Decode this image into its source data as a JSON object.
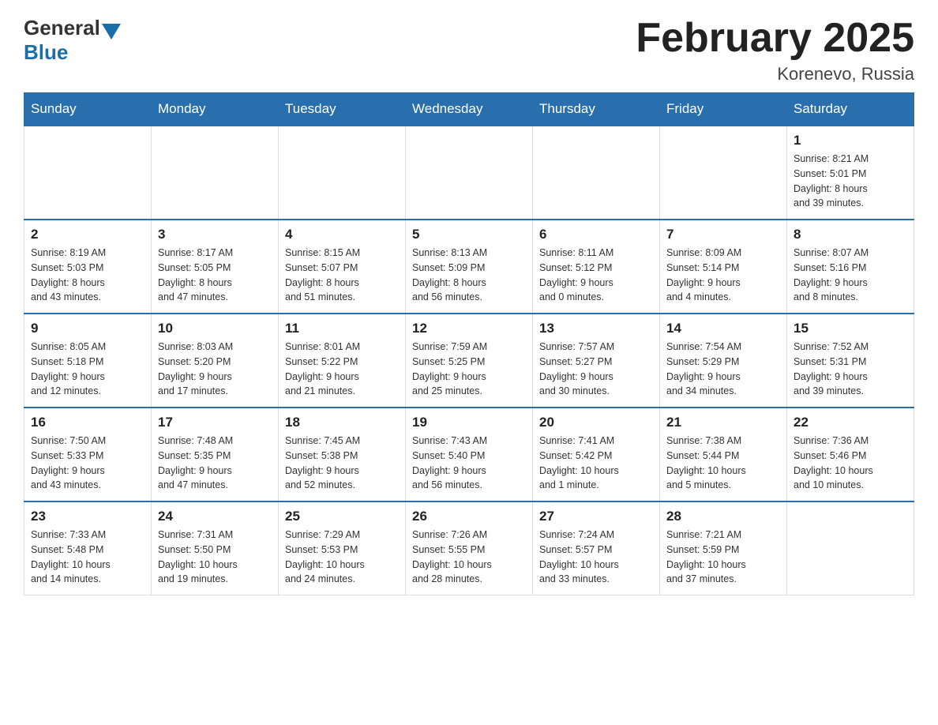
{
  "header": {
    "logo_general": "General",
    "logo_blue": "Blue",
    "month_title": "February 2025",
    "location": "Korenevo, Russia"
  },
  "weekdays": [
    "Sunday",
    "Monday",
    "Tuesday",
    "Wednesday",
    "Thursday",
    "Friday",
    "Saturday"
  ],
  "weeks": [
    [
      {
        "day": "",
        "info": ""
      },
      {
        "day": "",
        "info": ""
      },
      {
        "day": "",
        "info": ""
      },
      {
        "day": "",
        "info": ""
      },
      {
        "day": "",
        "info": ""
      },
      {
        "day": "",
        "info": ""
      },
      {
        "day": "1",
        "info": "Sunrise: 8:21 AM\nSunset: 5:01 PM\nDaylight: 8 hours\nand 39 minutes."
      }
    ],
    [
      {
        "day": "2",
        "info": "Sunrise: 8:19 AM\nSunset: 5:03 PM\nDaylight: 8 hours\nand 43 minutes."
      },
      {
        "day": "3",
        "info": "Sunrise: 8:17 AM\nSunset: 5:05 PM\nDaylight: 8 hours\nand 47 minutes."
      },
      {
        "day": "4",
        "info": "Sunrise: 8:15 AM\nSunset: 5:07 PM\nDaylight: 8 hours\nand 51 minutes."
      },
      {
        "day": "5",
        "info": "Sunrise: 8:13 AM\nSunset: 5:09 PM\nDaylight: 8 hours\nand 56 minutes."
      },
      {
        "day": "6",
        "info": "Sunrise: 8:11 AM\nSunset: 5:12 PM\nDaylight: 9 hours\nand 0 minutes."
      },
      {
        "day": "7",
        "info": "Sunrise: 8:09 AM\nSunset: 5:14 PM\nDaylight: 9 hours\nand 4 minutes."
      },
      {
        "day": "8",
        "info": "Sunrise: 8:07 AM\nSunset: 5:16 PM\nDaylight: 9 hours\nand 8 minutes."
      }
    ],
    [
      {
        "day": "9",
        "info": "Sunrise: 8:05 AM\nSunset: 5:18 PM\nDaylight: 9 hours\nand 12 minutes."
      },
      {
        "day": "10",
        "info": "Sunrise: 8:03 AM\nSunset: 5:20 PM\nDaylight: 9 hours\nand 17 minutes."
      },
      {
        "day": "11",
        "info": "Sunrise: 8:01 AM\nSunset: 5:22 PM\nDaylight: 9 hours\nand 21 minutes."
      },
      {
        "day": "12",
        "info": "Sunrise: 7:59 AM\nSunset: 5:25 PM\nDaylight: 9 hours\nand 25 minutes."
      },
      {
        "day": "13",
        "info": "Sunrise: 7:57 AM\nSunset: 5:27 PM\nDaylight: 9 hours\nand 30 minutes."
      },
      {
        "day": "14",
        "info": "Sunrise: 7:54 AM\nSunset: 5:29 PM\nDaylight: 9 hours\nand 34 minutes."
      },
      {
        "day": "15",
        "info": "Sunrise: 7:52 AM\nSunset: 5:31 PM\nDaylight: 9 hours\nand 39 minutes."
      }
    ],
    [
      {
        "day": "16",
        "info": "Sunrise: 7:50 AM\nSunset: 5:33 PM\nDaylight: 9 hours\nand 43 minutes."
      },
      {
        "day": "17",
        "info": "Sunrise: 7:48 AM\nSunset: 5:35 PM\nDaylight: 9 hours\nand 47 minutes."
      },
      {
        "day": "18",
        "info": "Sunrise: 7:45 AM\nSunset: 5:38 PM\nDaylight: 9 hours\nand 52 minutes."
      },
      {
        "day": "19",
        "info": "Sunrise: 7:43 AM\nSunset: 5:40 PM\nDaylight: 9 hours\nand 56 minutes."
      },
      {
        "day": "20",
        "info": "Sunrise: 7:41 AM\nSunset: 5:42 PM\nDaylight: 10 hours\nand 1 minute."
      },
      {
        "day": "21",
        "info": "Sunrise: 7:38 AM\nSunset: 5:44 PM\nDaylight: 10 hours\nand 5 minutes."
      },
      {
        "day": "22",
        "info": "Sunrise: 7:36 AM\nSunset: 5:46 PM\nDaylight: 10 hours\nand 10 minutes."
      }
    ],
    [
      {
        "day": "23",
        "info": "Sunrise: 7:33 AM\nSunset: 5:48 PM\nDaylight: 10 hours\nand 14 minutes."
      },
      {
        "day": "24",
        "info": "Sunrise: 7:31 AM\nSunset: 5:50 PM\nDaylight: 10 hours\nand 19 minutes."
      },
      {
        "day": "25",
        "info": "Sunrise: 7:29 AM\nSunset: 5:53 PM\nDaylight: 10 hours\nand 24 minutes."
      },
      {
        "day": "26",
        "info": "Sunrise: 7:26 AM\nSunset: 5:55 PM\nDaylight: 10 hours\nand 28 minutes."
      },
      {
        "day": "27",
        "info": "Sunrise: 7:24 AM\nSunset: 5:57 PM\nDaylight: 10 hours\nand 33 minutes."
      },
      {
        "day": "28",
        "info": "Sunrise: 7:21 AM\nSunset: 5:59 PM\nDaylight: 10 hours\nand 37 minutes."
      },
      {
        "day": "",
        "info": ""
      }
    ]
  ]
}
